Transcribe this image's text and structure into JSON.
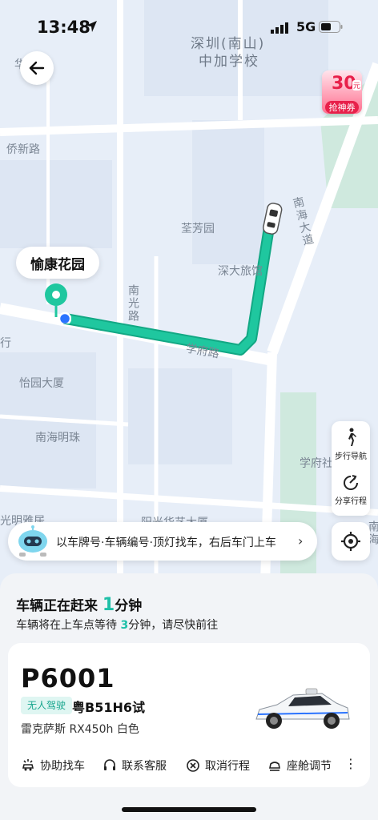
{
  "status_bar": {
    "time": "13:48",
    "network": "5G"
  },
  "coupon": {
    "amount": "30",
    "unit": "元",
    "label": "抢神券"
  },
  "map": {
    "labels": {
      "school": "深圳(南山)",
      "school2": "中加学校",
      "village": "华侨村",
      "qiaoxin_rd": "侨新路",
      "quanfang": "荃芳园",
      "shenda": "深大旅馆",
      "nanguang_rd": "南光路",
      "xuefu_rd": "学府路",
      "yiyuan": "怡园大厦",
      "nanhai_mingzhu": "南海明珠",
      "nanhai_ave": "南海大道",
      "xuefu_community": "学府社区",
      "guangming": "光明雅居",
      "yangguang": "阳光华艺大厦",
      "hang": "行",
      "nanhai_side": "南海",
      "pickup": "愉康花园"
    }
  },
  "side_tools": {
    "walk_nav": "步行导航",
    "share_trip": "分享行程"
  },
  "hint": {
    "text": "以车牌号·车辆编号·顶灯找车，右后车门上车"
  },
  "eta": {
    "title_prefix": "车辆正在赶来",
    "minutes": "1",
    "title_suffix": "分钟",
    "sub_prefix": "车辆将在上车点等待",
    "wait_minutes": "3",
    "sub_suffix": "分钟，请尽快前往"
  },
  "vehicle": {
    "plate_code": "P6001",
    "tag": "无人驾驶",
    "license": "粤B51H6试",
    "model": "雷克萨斯 RX450h 白色"
  },
  "actions": {
    "find_car": "协助找车",
    "contact": "联系客服",
    "cancel": "取消行程",
    "seat": "座舱调节"
  },
  "colors": {
    "route": "#1fc79f",
    "accent": "#1fc0a8",
    "coupon": "#e8204a",
    "pickup_pin": "#1fc79f",
    "user_dot": "#2a73ff"
  }
}
